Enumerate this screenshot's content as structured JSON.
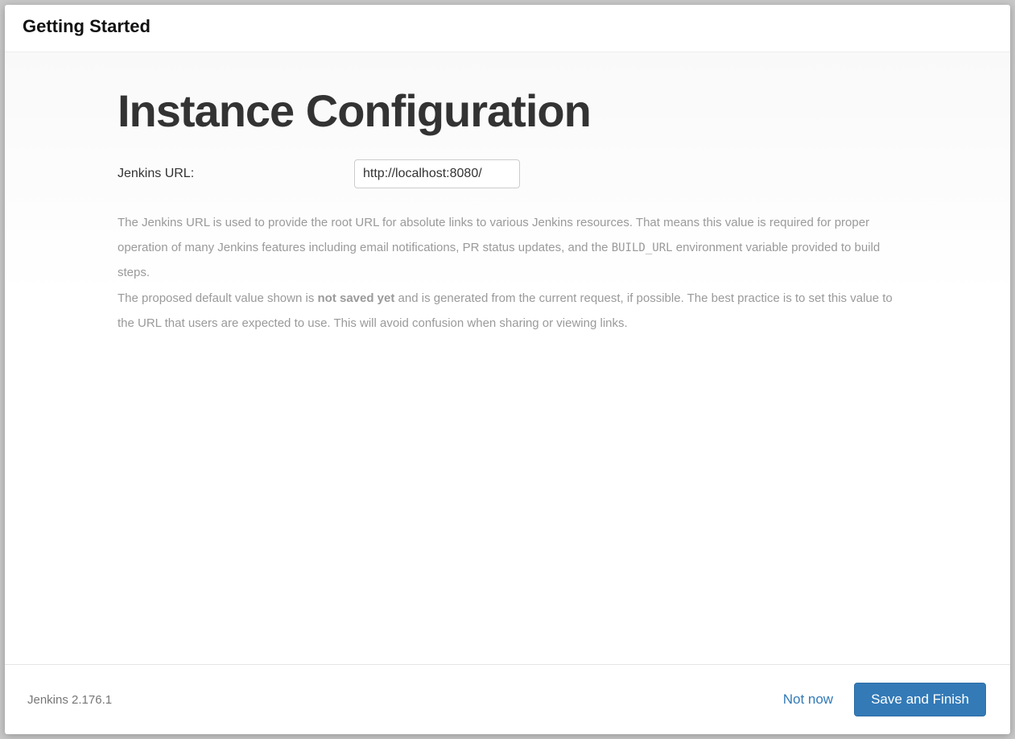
{
  "header": {
    "title": "Getting Started"
  },
  "main": {
    "title": "Instance Configuration",
    "form": {
      "url_label": "Jenkins URL:",
      "url_value": "http://localhost:8080/"
    },
    "help": {
      "p1_a": "The Jenkins URL is used to provide the root URL for absolute links to various Jenkins resources. That means this value is required for proper operation of many Jenkins features including email notifications, PR status updates, and the ",
      "p1_code": "BUILD_URL",
      "p1_b": " environment variable provided to build steps.",
      "p2_a": "The proposed default value shown is ",
      "p2_bold": "not saved yet",
      "p2_b": " and is generated from the current request, if possible. The best practice is to set this value to the URL that users are expected to use. This will avoid confusion when sharing or viewing links."
    }
  },
  "footer": {
    "version": "Jenkins 2.176.1",
    "not_now_label": "Not now",
    "save_label": "Save and Finish"
  }
}
